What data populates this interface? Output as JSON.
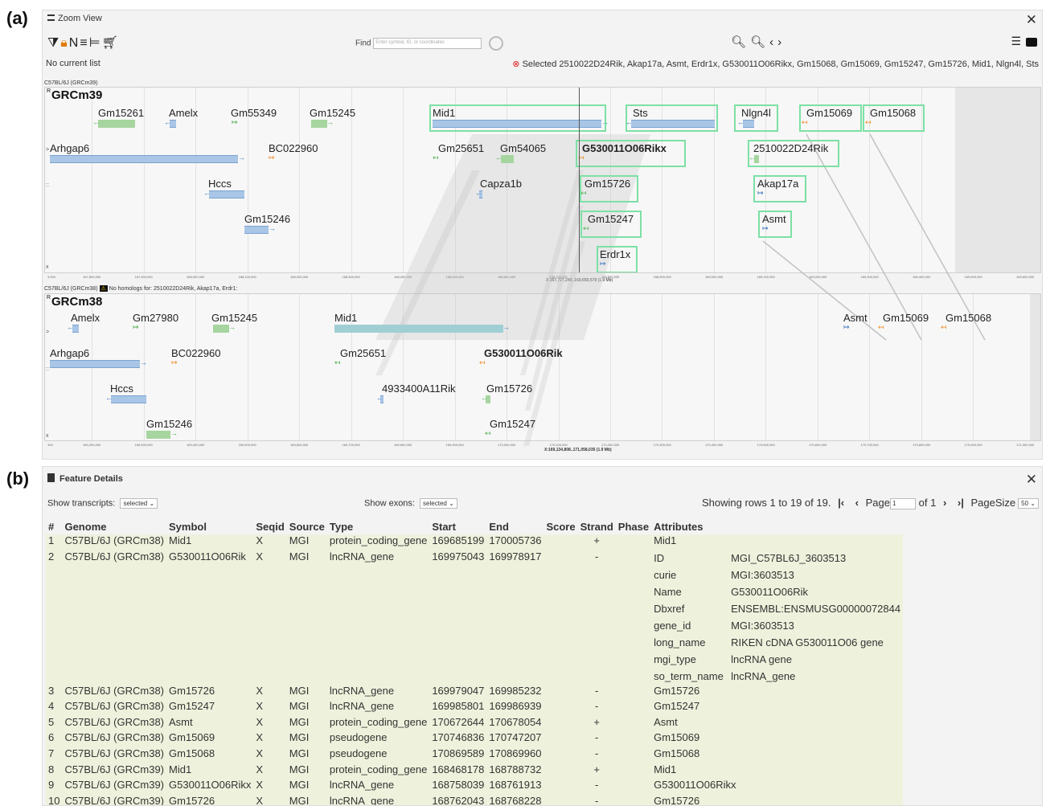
{
  "panel_a": "(a)",
  "panel_b": "(b)",
  "zoom": {
    "title": "Zoom View",
    "find_label": "Find",
    "find_placeholder": "Enter symbol, ID, or coordinates",
    "no_list": "No current list",
    "selected": "Selected 2510022D24Rik, Akap17a, Asmt, Erdr1x, G530011O06Rikx, Gm15068, Gm15069, Gm15247, Gm15726, Mid1, Nlgn4l, Sts",
    "toolbar_text": "N",
    "track1": {
      "strain": "C57BL/6J (GRCm39)",
      "assembly": "GRCm39",
      "genes": {
        "gm15261": "Gm15261",
        "amelx": "Amelx",
        "gm55349": "Gm55349",
        "gm15245": "Gm15245",
        "mid1": "Mid1",
        "sts": "Sts",
        "nlgn4l": "Nlgn4l",
        "gm15069": "Gm15069",
        "gm15068": "Gm15068",
        "arhgap6": "Arhgap6",
        "bc022960": "BC022960",
        "gm25651": "Gm25651",
        "gm54065": "Gm54065",
        "g530011o06rikx": "G530011O06Rikx",
        "rik2510022d24": "2510022D24Rik",
        "hccs": "Hccs",
        "capza1b": "Capza1b",
        "gm15726": "Gm15726",
        "akap17a": "Akap17a",
        "gm15246": "Gm15246",
        "gm15247": "Gm15247",
        "asmt": "Asmt",
        "erdr1x": "Erdr1x"
      },
      "ruler": [
        "167,800,000",
        "167,900,000",
        "168,000,000",
        "168,100,000",
        "168,200,000",
        "168,300,000",
        "168,400,000",
        "168,500,000",
        "168,600,000",
        "168,700,000",
        "168,800,000",
        "168,900,000",
        "169,000,000",
        "169,100,000",
        "169,200,000",
        "169,300,000",
        "169,400,000",
        "169,500,000",
        "169,600,000"
      ],
      "ruler_start": "3,000",
      "ruler_readout": "X:167,727,249..169,650,578 (1.9 Mb)"
    },
    "track2": {
      "strain": "C57BL/6J (GRCm38)",
      "nohomolog": "No homologs for: 2510022D24Rik, Akap17a, Erdr1:",
      "assembly": "GRCm38",
      "genes": {
        "amelx": "Amelx",
        "gm27980": "Gm27980",
        "gm15245": "Gm15245",
        "mid1": "Mid1",
        "asmt": "Asmt",
        "gm15069": "Gm15069",
        "gm15068": "Gm15068",
        "arhgap6": "Arhgap6",
        "bc022960": "BC022960",
        "gm25651": "Gm25651",
        "g530011o06rik": "G530011O06Rik",
        "hccs": "Hccs",
        "rik4933400a11": "4933400A11Rik",
        "gm15726": "Gm15726",
        "gm15246": "Gm15246",
        "gm15247": "Gm15247"
      },
      "ruler": [
        "169,200,000",
        "169,300,000",
        "169,400,000",
        "169,500,000",
        "169,600,000",
        "169,700,000",
        "169,800,000",
        "169,900,000",
        "170,000,000",
        "170,100,000",
        "170,200,000",
        "170,300,000",
        "170,400,000",
        "170,500,000",
        "170,600,000",
        "170,700,000",
        "170,800,000",
        "170,900,000",
        "171,000,000"
      ],
      "ruler_start": "100",
      "ruler_readout": "X:169,134,808..171,058,035 (1.9 Mb)"
    }
  },
  "details": {
    "title": "Feature Details",
    "show_transcripts_label": "Show transcripts:",
    "show_transcripts_value": "selected",
    "show_exons_label": "Show exons:",
    "show_exons_value": "selected",
    "pager_text": "Showing rows 1 to 19 of 19.",
    "page_label": "Page",
    "page_value": "1",
    "page_of": "of 1",
    "page_size_label": "PageSize",
    "page_size_value": "50",
    "columns": [
      "#",
      "Genome",
      "Symbol",
      "Seqid",
      "Source",
      "Type",
      "Start",
      "End",
      "Score",
      "Strand",
      "Phase",
      "Attributes"
    ],
    "rows": [
      {
        "n": "1",
        "genome": "C57BL/6J (GRCm38)",
        "symbol": "Mid1",
        "seqid": "X",
        "source": "MGI",
        "type": "protein_coding_gene",
        "start": "169685199",
        "end": "170005736",
        "score": "",
        "strand": "+",
        "phase": "",
        "attr": "Mid1"
      },
      {
        "n": "2",
        "genome": "C57BL/6J (GRCm38)",
        "symbol": "G530011O06Rik",
        "seqid": "X",
        "source": "MGI",
        "type": "lncRNA_gene",
        "start": "169975043",
        "end": "169978917",
        "score": "",
        "strand": "-",
        "phase": "",
        "attrs": [
          [
            "ID",
            "MGI_C57BL6J_3603513"
          ],
          [
            "curie",
            "MGI:3603513"
          ],
          [
            "Name",
            "G530011O06Rik"
          ],
          [
            "Dbxref",
            "ENSEMBL:ENSMUSG00000072844"
          ],
          [
            "gene_id",
            "MGI:3603513"
          ],
          [
            "long_name",
            "RIKEN cDNA G530011O06 gene"
          ],
          [
            "mgi_type",
            "lncRNA gene"
          ],
          [
            "so_term_name",
            "lncRNA_gene"
          ]
        ]
      },
      {
        "n": "3",
        "genome": "C57BL/6J (GRCm38)",
        "symbol": "Gm15726",
        "seqid": "X",
        "source": "MGI",
        "type": "lncRNA_gene",
        "start": "169979047",
        "end": "169985232",
        "score": "",
        "strand": "-",
        "phase": "",
        "attr": "Gm15726"
      },
      {
        "n": "4",
        "genome": "C57BL/6J (GRCm38)",
        "symbol": "Gm15247",
        "seqid": "X",
        "source": "MGI",
        "type": "lncRNA_gene",
        "start": "169985801",
        "end": "169986939",
        "score": "",
        "strand": "-",
        "phase": "",
        "attr": "Gm15247"
      },
      {
        "n": "5",
        "genome": "C57BL/6J (GRCm38)",
        "symbol": "Asmt",
        "seqid": "X",
        "source": "MGI",
        "type": "protein_coding_gene",
        "start": "170672644",
        "end": "170678054",
        "score": "",
        "strand": "+",
        "phase": "",
        "attr": "Asmt"
      },
      {
        "n": "6",
        "genome": "C57BL/6J (GRCm38)",
        "symbol": "Gm15069",
        "seqid": "X",
        "source": "MGI",
        "type": "pseudogene",
        "start": "170746836",
        "end": "170747207",
        "score": "",
        "strand": "-",
        "phase": "",
        "attr": "Gm15069"
      },
      {
        "n": "7",
        "genome": "C57BL/6J (GRCm38)",
        "symbol": "Gm15068",
        "seqid": "X",
        "source": "MGI",
        "type": "pseudogene",
        "start": "170869589",
        "end": "170869960",
        "score": "",
        "strand": "-",
        "phase": "",
        "attr": "Gm15068"
      },
      {
        "n": "8",
        "genome": "C57BL/6J (GRCm39)",
        "symbol": "Mid1",
        "seqid": "X",
        "source": "MGI",
        "type": "protein_coding_gene",
        "start": "168468178",
        "end": "168788732",
        "score": "",
        "strand": "+",
        "phase": "",
        "attr": "Mid1"
      },
      {
        "n": "9",
        "genome": "C57BL/6J (GRCm39)",
        "symbol": "G530011O06Rikx",
        "seqid": "X",
        "source": "MGI",
        "type": "lncRNA_gene",
        "start": "168758039",
        "end": "168761913",
        "score": "",
        "strand": "-",
        "phase": "",
        "attr": "G530011O06Rikx"
      },
      {
        "n": "10",
        "genome": "C57BL/6J (GRCm39)",
        "symbol": "Gm15726",
        "seqid": "X",
        "source": "MGI",
        "type": "lncRNA_gene",
        "start": "168762043",
        "end": "168768228",
        "score": "",
        "strand": "-",
        "phase": "",
        "attr": "Gm15726"
      }
    ]
  }
}
